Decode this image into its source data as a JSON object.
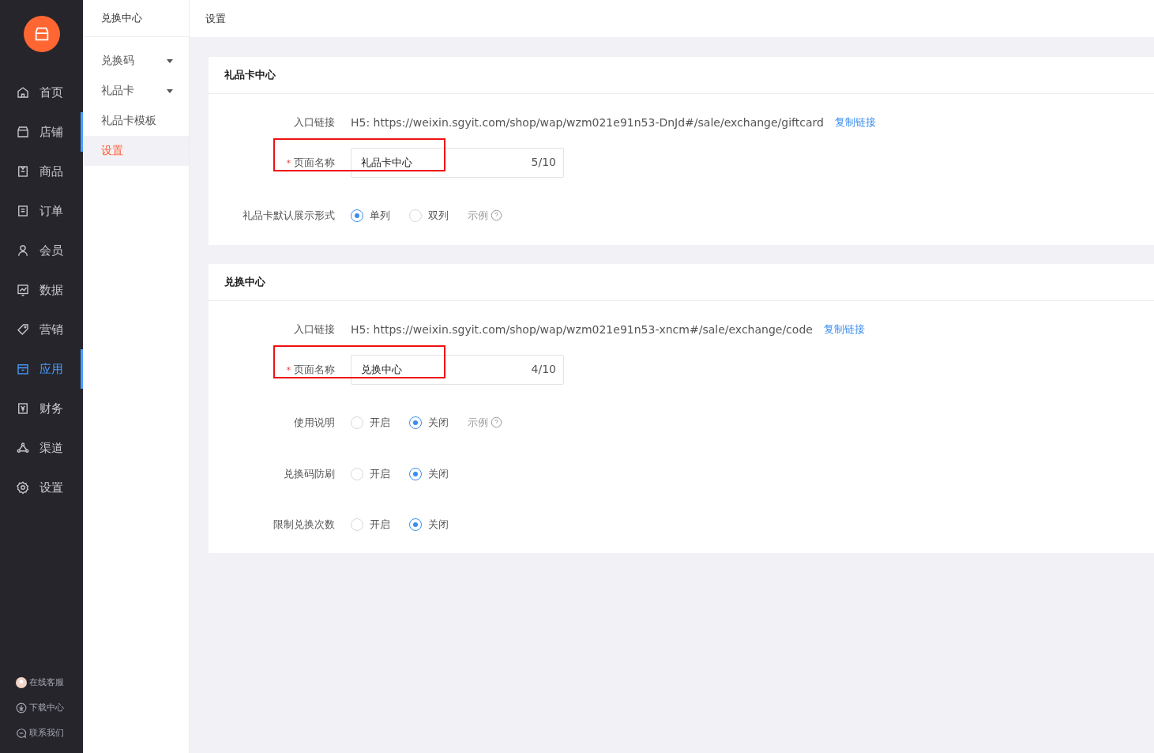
{
  "nav": {
    "items": [
      {
        "label": "首页",
        "selected": false,
        "indicator": false
      },
      {
        "label": "店铺",
        "selected": false,
        "indicator": true
      },
      {
        "label": "商品",
        "selected": false,
        "indicator": false
      },
      {
        "label": "订单",
        "selected": false,
        "indicator": false
      },
      {
        "label": "会员",
        "selected": false,
        "indicator": false
      },
      {
        "label": "数据",
        "selected": false,
        "indicator": false
      },
      {
        "label": "营销",
        "selected": false,
        "indicator": false
      },
      {
        "label": "应用",
        "selected": true,
        "indicator": true
      },
      {
        "label": "财务",
        "selected": false,
        "indicator": false
      },
      {
        "label": "渠道",
        "selected": false,
        "indicator": false
      },
      {
        "label": "设置",
        "selected": false,
        "indicator": false
      }
    ],
    "footer": [
      "在线客服",
      "下载中心",
      "联系我们"
    ]
  },
  "subnav": {
    "title": "兑换中心",
    "items": [
      {
        "label": "兑换码",
        "expandable": true,
        "selected": false
      },
      {
        "label": "礼品卡",
        "expandable": true,
        "selected": false
      },
      {
        "label": "礼品卡模板",
        "expandable": false,
        "selected": false
      },
      {
        "label": "设置",
        "expandable": false,
        "selected": true
      }
    ]
  },
  "header": {
    "title": "设置"
  },
  "sections": [
    {
      "title": "礼品卡中心",
      "rows": [
        {
          "kind": "link",
          "label": "入口链接",
          "value": "H5: https://weixin.sgyit.com/shop/wap/wzm021e91n53-DnJd#/sale/exchange/giftcard",
          "action": "复制链接"
        },
        {
          "kind": "field",
          "label": "页面名称",
          "required_mark": "*",
          "value": "礼品卡中心",
          "counter": "5/10",
          "highlighted": true
        },
        {
          "kind": "radio",
          "label": "礼品卡默认展示形式",
          "options": [
            {
              "label": "单列",
              "selected": true
            },
            {
              "label": "双列",
              "selected": false
            }
          ],
          "example": "示例"
        }
      ]
    },
    {
      "title": "兑换中心",
      "rows": [
        {
          "kind": "link",
          "label": "入口链接",
          "value": "H5: https://weixin.sgyit.com/shop/wap/wzm021e91n53-xncm#/sale/exchange/code",
          "action": "复制链接"
        },
        {
          "kind": "field",
          "label": "页面名称",
          "required_mark": "*",
          "value": "兑换中心",
          "counter": "4/10",
          "highlighted": true
        },
        {
          "kind": "radio",
          "label": "使用说明",
          "options": [
            {
              "label": "开启",
              "selected": false
            },
            {
              "label": "关闭",
              "selected": true
            }
          ],
          "example": "示例"
        },
        {
          "kind": "radio",
          "label": "兑换码防刷",
          "options": [
            {
              "label": "开启",
              "selected": false
            },
            {
              "label": "关闭",
              "selected": true
            }
          ]
        },
        {
          "kind": "radio",
          "label": "限制兑换次数",
          "options": [
            {
              "label": "开启",
              "selected": false
            },
            {
              "label": "关闭",
              "selected": true
            }
          ]
        }
      ]
    }
  ]
}
